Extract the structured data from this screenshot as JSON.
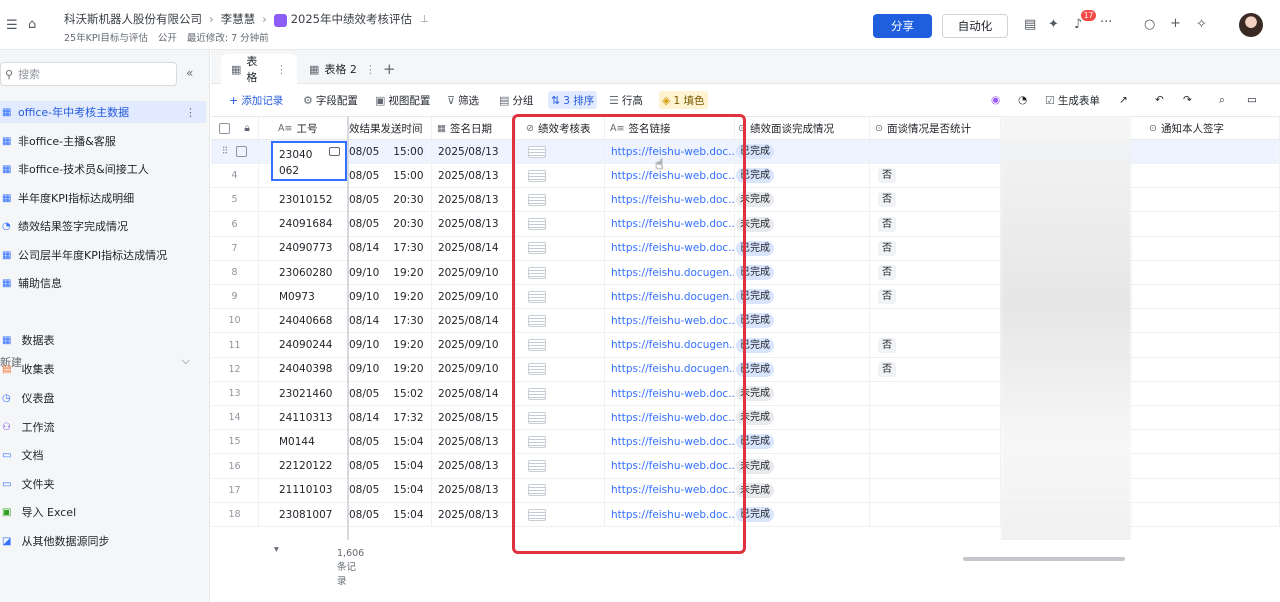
{
  "breadcrumb": {
    "org": "科沃斯机器人股份有限公司",
    "owner": "李慧慧",
    "doc_title": "2025年中绩效考核评估"
  },
  "subline": {
    "folder": "25年KPI目标与评估",
    "visibility": "公开",
    "modified": "最近修改: 7 分钟前"
  },
  "header_actions": {
    "share": "分享",
    "automation": "自动化",
    "notif_count": "17"
  },
  "sidebar": {
    "search_placeholder": "搜索",
    "tables": [
      "office-年中考核主数据",
      "非office-主播&客服",
      "非office-技术员&间接工人",
      "半年度KPI指标达成明细",
      "绩效结果签字完成情况",
      "公司层半年度KPI指标达成情况",
      "辅助信息"
    ],
    "new_label": "新建",
    "new_items": [
      "数据表",
      "收集表",
      "仪表盘",
      "工作流",
      "文档",
      "文件夹",
      "导入 Excel",
      "从其他数据源同步"
    ]
  },
  "tabs": [
    "表格",
    "表格 2"
  ],
  "toolbar": {
    "add_record": "添加记录",
    "field_config": "字段配置",
    "view_config": "视图配置",
    "filter": "筛选",
    "group": "分组",
    "sort": "3 排序",
    "row_height": "行高",
    "fill": "1 填色",
    "generate_form": "生成表单"
  },
  "columns": {
    "id": "工号",
    "sent_time": "效结果发送时间",
    "sign_date": "签名日期",
    "sheet": "绩效考核表",
    "link": "签名链接",
    "interview": "绩效面谈完成情况",
    "stat": "面谈情况是否统计",
    "notify": "通知本人签字"
  },
  "editing_cell": "23040062",
  "rows": [
    {
      "n": "",
      "id": "",
      "date": "08/05",
      "time": "15:00",
      "sign": "2025/08/13",
      "link": "https://feishu-web.doc...",
      "status": "已完成",
      "stat": ""
    },
    {
      "n": "4",
      "id": "",
      "date": "08/05",
      "time": "15:00",
      "sign": "2025/08/13",
      "link": "https://feishu-web.doc...",
      "status": "已完成",
      "stat": "否"
    },
    {
      "n": "5",
      "id": "23010152",
      "date": "08/05",
      "time": "20:30",
      "sign": "2025/08/13",
      "link": "https://feishu-web.doc...",
      "status": "未完成",
      "stat": "否"
    },
    {
      "n": "6",
      "id": "24091684",
      "date": "08/05",
      "time": "20:30",
      "sign": "2025/08/13",
      "link": "https://feishu-web.doc...",
      "status": "未完成",
      "stat": "否"
    },
    {
      "n": "7",
      "id": "24090773",
      "date": "08/14",
      "time": "17:30",
      "sign": "2025/08/14",
      "link": "https://feishu-web.doc...",
      "status": "已完成",
      "stat": "否"
    },
    {
      "n": "8",
      "id": "23060280",
      "date": "09/10",
      "time": "19:20",
      "sign": "2025/09/10",
      "link": "https://feishu.docugen...",
      "status": "已完成",
      "stat": "否"
    },
    {
      "n": "9",
      "id": "M0973",
      "date": "09/10",
      "time": "19:20",
      "sign": "2025/09/10",
      "link": "https://feishu.docugen...",
      "status": "已完成",
      "stat": "否"
    },
    {
      "n": "10",
      "id": "24040668",
      "date": "08/14",
      "time": "17:30",
      "sign": "2025/08/14",
      "link": "https://feishu-web.doc...",
      "status": "已完成",
      "stat": ""
    },
    {
      "n": "11",
      "id": "24090244",
      "date": "09/10",
      "time": "19:20",
      "sign": "2025/09/10",
      "link": "https://feishu.docugen...",
      "status": "已完成",
      "stat": "否"
    },
    {
      "n": "12",
      "id": "24040398",
      "date": "09/10",
      "time": "19:20",
      "sign": "2025/09/10",
      "link": "https://feishu.docugen...",
      "status": "已完成",
      "stat": "否"
    },
    {
      "n": "13",
      "id": "23021460",
      "date": "08/05",
      "time": "15:02",
      "sign": "2025/08/14",
      "link": "https://feishu-web.doc...",
      "status": "未完成",
      "stat": ""
    },
    {
      "n": "14",
      "id": "24110313",
      "date": "08/14",
      "time": "17:32",
      "sign": "2025/08/15",
      "link": "https://feishu-web.doc...",
      "status": "未完成",
      "stat": ""
    },
    {
      "n": "15",
      "id": "M0144",
      "date": "08/05",
      "time": "15:04",
      "sign": "2025/08/13",
      "link": "https://feishu-web.doc...",
      "status": "已完成",
      "stat": ""
    },
    {
      "n": "16",
      "id": "22120122",
      "date": "08/05",
      "time": "15:04",
      "sign": "2025/08/13",
      "link": "https://feishu-web.doc...",
      "status": "未完成",
      "stat": ""
    },
    {
      "n": "17",
      "id": "21110103",
      "date": "08/05",
      "time": "15:04",
      "sign": "2025/08/13",
      "link": "https://feishu-web.doc...",
      "status": "未完成",
      "stat": ""
    },
    {
      "n": "18",
      "id": "23081007",
      "date": "08/05",
      "time": "15:04",
      "sign": "2025/08/13",
      "link": "https://feishu-web.doc...",
      "status": "已完成",
      "stat": ""
    }
  ],
  "footer": {
    "record_count": "1,606 条记录"
  },
  "colors": {
    "accent": "#3370ff",
    "share": "#1f5fde",
    "highlight_box": "#e0323e"
  }
}
